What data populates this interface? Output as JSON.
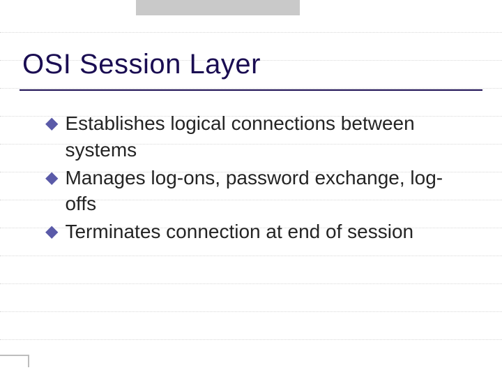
{
  "slide": {
    "title": "OSI Session Layer",
    "bullets": [
      "Establishes logical connections between systems",
      "Manages log-ons, password exchange, log-offs",
      "Terminates connection at end of session"
    ]
  }
}
